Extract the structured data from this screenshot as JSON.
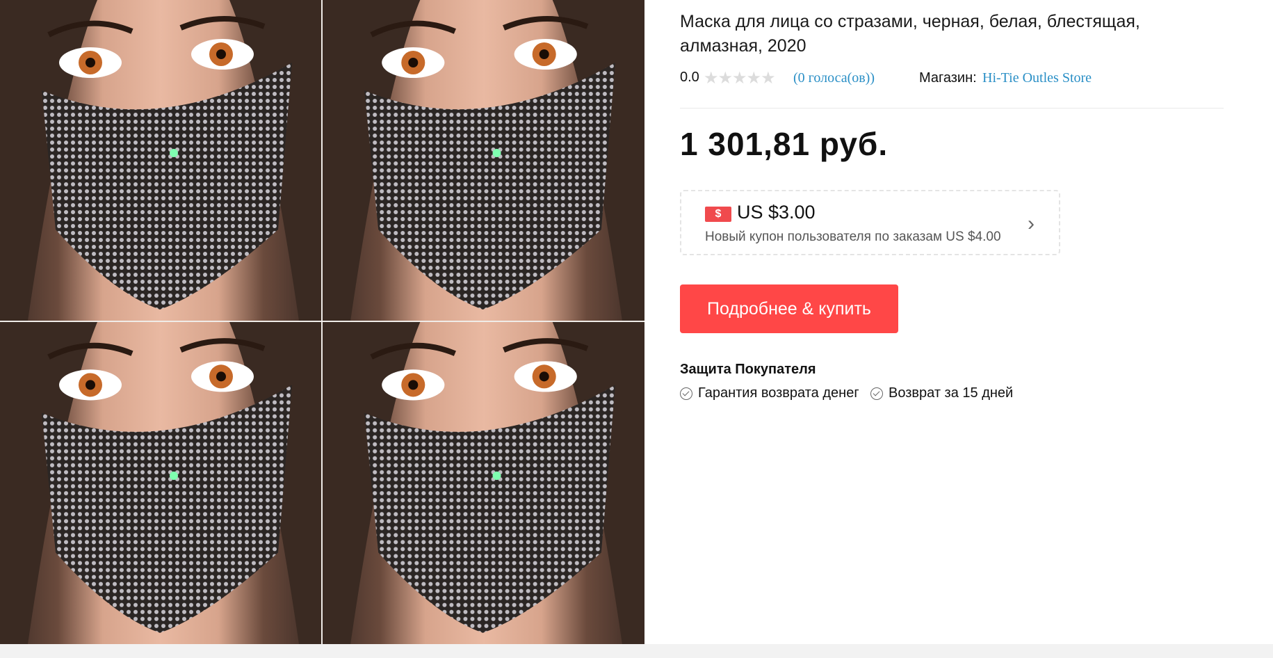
{
  "product": {
    "title": "Маска для лица со стразами, черная, белая, блестящая, алмазная, 2020",
    "rating_score": "0.0",
    "stars": "★★★★★",
    "votes": "(0 голоса(ов))",
    "store_label": "Магазин:",
    "store_name": "Hi-Tie Outles Store",
    "price": "1 301,81 руб."
  },
  "coupon": {
    "icon_symbol": "$",
    "amount": "US $3.00",
    "description": "Новый купон пользователя по заказам US $4.00"
  },
  "buy_button": {
    "label": "Подробнее & купить"
  },
  "protection": {
    "title": "Защита Покупателя",
    "items": [
      "Гарантия возврата денег",
      "Возврат за 15 дней"
    ]
  },
  "gallery": {
    "tiles": [
      "masked-woman-photo",
      "masked-woman-photo",
      "masked-woman-photo",
      "masked-woman-photo"
    ]
  },
  "colors": {
    "accent_red": "#ff4747",
    "link_blue": "#2a8fc6",
    "star_gray": "#dcdcdc"
  }
}
